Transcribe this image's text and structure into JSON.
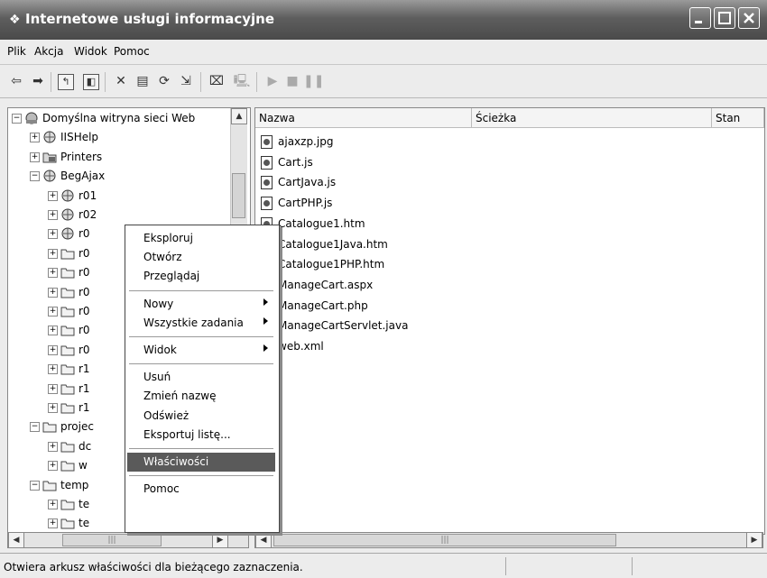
{
  "window": {
    "title": "Internetowe usługi informacyjne",
    "icon": "iis-icon"
  },
  "menubar": [
    "Plik",
    "Akcja",
    "Widok",
    "Pomoc"
  ],
  "tree": {
    "items": [
      {
        "label": "Domyślna witryna sieci Web",
        "icon": "web-site-icon",
        "exp": "−"
      },
      {
        "label": "IISHelp",
        "icon": "virtual-dir-icon",
        "exp": "+"
      },
      {
        "label": "Printers",
        "icon": "printers-icon",
        "exp": "+"
      },
      {
        "label": "BegAjax",
        "icon": "virtual-dir-icon",
        "exp": "−"
      },
      {
        "label": "r01",
        "icon": "virtual-dir-icon",
        "exp": "+"
      },
      {
        "label": "r02",
        "icon": "virtual-dir-icon",
        "exp": "+"
      },
      {
        "label": "r0",
        "icon": "virtual-dir-icon",
        "exp": "+"
      },
      {
        "label": "r0",
        "icon": "folder-icon",
        "exp": "+"
      },
      {
        "label": "r0",
        "icon": "folder-icon",
        "exp": "+"
      },
      {
        "label": "r0",
        "icon": "folder-icon",
        "exp": "+"
      },
      {
        "label": "r0",
        "icon": "folder-icon",
        "exp": "+"
      },
      {
        "label": "r0",
        "icon": "folder-icon",
        "exp": "+"
      },
      {
        "label": "r0",
        "icon": "folder-icon",
        "exp": "+"
      },
      {
        "label": "r1",
        "icon": "folder-icon",
        "exp": "+"
      },
      {
        "label": "r1",
        "icon": "folder-icon",
        "exp": "+"
      },
      {
        "label": "r1",
        "icon": "folder-icon",
        "exp": "+"
      },
      {
        "label": "projec",
        "icon": "folder-icon",
        "exp": "−"
      },
      {
        "label": "dc",
        "icon": "folder-icon",
        "exp": "+"
      },
      {
        "label": "w",
        "icon": "folder-icon",
        "exp": "+"
      },
      {
        "label": "temp",
        "icon": "folder-icon",
        "exp": "−"
      },
      {
        "label": "te",
        "icon": "folder-icon",
        "exp": "+"
      },
      {
        "label": "te",
        "icon": "folder-icon",
        "exp": "+"
      }
    ]
  },
  "list": {
    "columns": [
      "Nazwa",
      "Ścieżka",
      "Stan"
    ],
    "files": [
      "ajaxzp.jpg",
      "Cart.js",
      "CartJava.js",
      "CartPHP.js",
      "Catalogue1.htm",
      "Catalogue1Java.htm",
      "Catalogue1PHP.htm",
      "ManageCart.aspx",
      "ManageCart.php",
      "ManageCartServlet.java",
      "web.xml"
    ]
  },
  "context_menu": {
    "items": [
      {
        "label": "Eksploruj"
      },
      {
        "label": "Otwórz"
      },
      {
        "label": "Przeglądaj"
      },
      {
        "sep": true
      },
      {
        "label": "Nowy",
        "submenu": true
      },
      {
        "label": "Wszystkie zadania",
        "submenu": true
      },
      {
        "sep": true
      },
      {
        "label": "Widok",
        "submenu": true
      },
      {
        "sep": true
      },
      {
        "label": "Usuń"
      },
      {
        "label": "Zmień nazwę"
      },
      {
        "label": "Odśwież"
      },
      {
        "label": "Eksportuj listę..."
      },
      {
        "sep": true
      },
      {
        "label": "Właściwości",
        "selected": true
      },
      {
        "sep": true
      },
      {
        "label": "Pomoc"
      }
    ]
  },
  "status": {
    "text": "Otwiera arkusz właściwości dla bieżącego zaznaczenia."
  }
}
